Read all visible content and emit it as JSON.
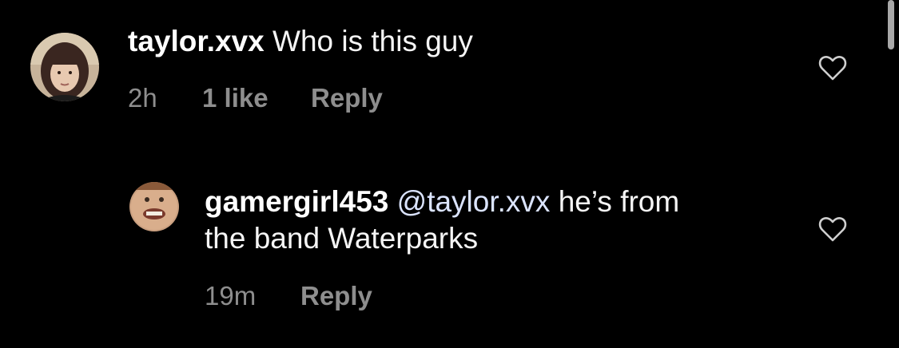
{
  "comments": [
    {
      "username": "taylor.xvx",
      "text": "Who is this guy",
      "time": "2h",
      "likes": "1 like",
      "reply_label": "Reply",
      "avatar_icon": "profile-photo"
    },
    {
      "username": "gamergirl453",
      "mention": "@taylor.xvx",
      "text_line1": "he’s from",
      "text_line2": "the band Waterparks",
      "time": "19m",
      "reply_label": "Reply",
      "avatar_icon": "profile-photo"
    }
  ],
  "icons": {
    "like": "heart-outline-icon"
  },
  "colors": {
    "background": "#000000",
    "text": "#ffffff",
    "meta": "#8e8e8e",
    "mention": "#dbe4ff"
  }
}
